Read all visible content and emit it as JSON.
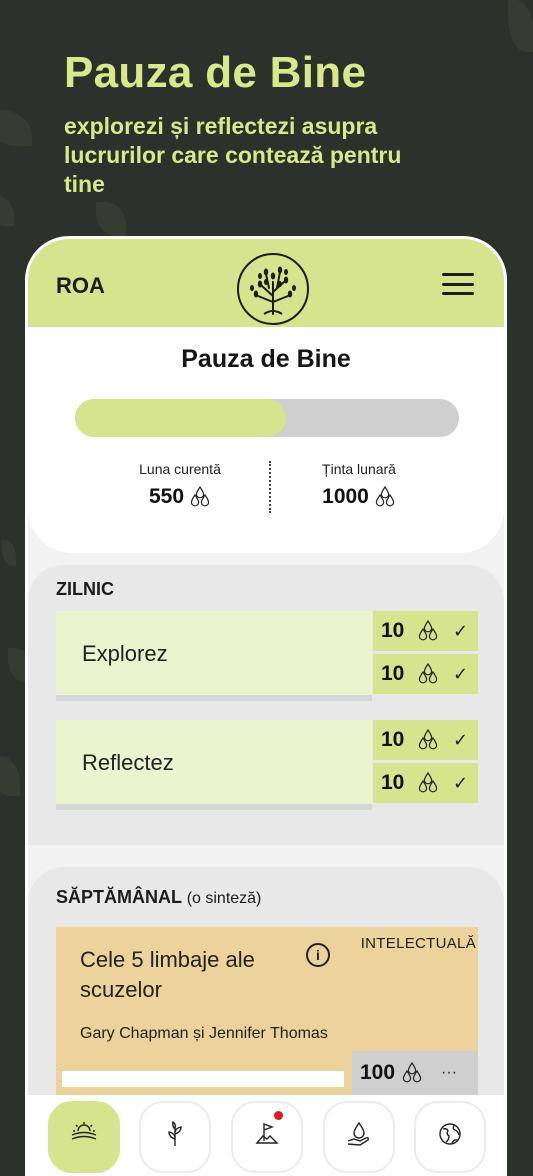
{
  "hero": {
    "title": "Pauza de Bine",
    "subtitle": "explorezi și reflectezi asupra lucrurilor care contează pentru tine"
  },
  "app": {
    "brand": "ROA",
    "menu_icon": "hamburger-menu-icon",
    "logo_icon": "tree-logo-icon"
  },
  "summary": {
    "title": "Pauza de Bine",
    "progress_fraction": 0.55,
    "current_label": "Luna curentă",
    "current_value": "550",
    "target_label": "Ținta lunară",
    "target_value": "1000",
    "unit_icon": "drops-icon"
  },
  "daily": {
    "title": "ZILNIC",
    "cards": [
      {
        "label": "Explorez",
        "rewards": [
          {
            "value": "10",
            "checked": true
          },
          {
            "value": "10",
            "checked": true
          }
        ]
      },
      {
        "label": "Reflectez",
        "rewards": [
          {
            "value": "10",
            "checked": true
          },
          {
            "value": "10",
            "checked": true
          }
        ]
      }
    ],
    "check_glyph": "✓"
  },
  "weekly": {
    "title": "SĂPTĂMÂNAL",
    "subtitle": "(o sinteză)",
    "book": {
      "title": "Cele 5 limbaje ale scuzelor",
      "category": "INTELECTUALĂ",
      "author": "Gary Chapman și Jennifer Thomas",
      "reward": "100",
      "more": "···",
      "info_glyph": "i"
    }
  },
  "tabs": [
    {
      "icon": "sunrise-landscape-icon",
      "active": true
    },
    {
      "icon": "sprout-icon",
      "active": false
    },
    {
      "icon": "summit-flag-icon",
      "active": false,
      "badge": true
    },
    {
      "icon": "hand-drop-icon",
      "active": false
    },
    {
      "icon": "globe-icon",
      "active": false
    }
  ],
  "colors": {
    "accent": "#d5e48d",
    "background": "#2d312b",
    "badge": "#e01b1b",
    "book_card": "#ecd39b"
  }
}
